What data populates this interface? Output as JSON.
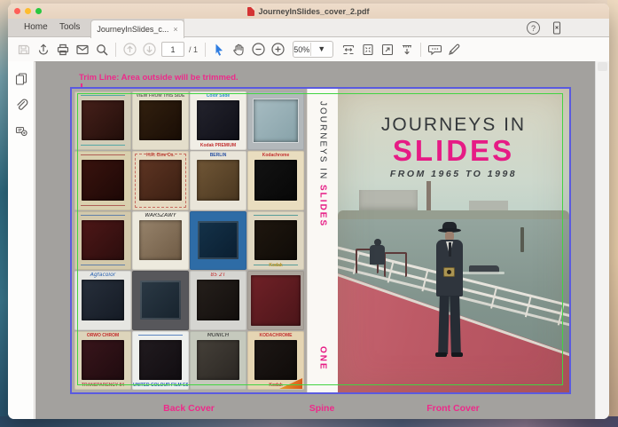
{
  "colors": {
    "accent_pink": "#ed2a8a",
    "title_pink": "#e61b85",
    "trim_green": "#42d442",
    "border_blue": "#5a5ae0",
    "select_blue": "#2f7de1"
  },
  "window": {
    "title": "JourneyInSlides_cover_2.pdf",
    "tab_home": "Home",
    "tab_tools": "Tools",
    "tab_document": "JourneyInSlides_c...",
    "tab_close": "×",
    "help": "?"
  },
  "toolbar": {
    "page_current": "1",
    "page_total": "/ 1",
    "zoom_level": "50%"
  },
  "annotations": {
    "trim_note": "Trim Line: Area outside will be trimmed.",
    "back_cover_label": "Back Cover",
    "spine_label": "Spine",
    "front_cover_label": "Front Cover"
  },
  "cover": {
    "front_title_line1": "JOURNEYS IN",
    "front_title_line2": "SLIDES",
    "front_subtitle": "FROM 1965 TO 1998",
    "spine_title_line1": "JOURNEYS IN",
    "spine_title_line2": "SLIDES",
    "spine_volume": "ONE"
  },
  "back_cover": {
    "slides": [
      {
        "f": "#d2cdb8",
        "p1": "#46201a",
        "p2": "#220e0a",
        "rules": "#2a9aa0"
      },
      {
        "f": "#e4decb",
        "p1": "#32200f",
        "p2": "#190d05",
        "t": "VIEW FROM THIS SIDE",
        "tc": "#6a675f"
      },
      {
        "f": "#f1eee6",
        "p1": "#23232d",
        "p2": "#101018",
        "t": "Color Slide",
        "tc": "#2d8ccc",
        "b": "Kodak PREMIUM",
        "bc": "#c23030"
      },
      {
        "f": "#b3b8bb",
        "p1": "#a7bcc2",
        "p2": "#87a2a9",
        "cls": "metal"
      },
      {
        "f": "#d9d0ae",
        "p1": "#3a130e",
        "p2": "#1d0806",
        "rules": "#a03a3a"
      },
      {
        "f": "#e5dac1",
        "p1": "#5e3523",
        "p2": "#3b1f12",
        "t": "H.R. Cine Co.",
        "tc": "#b83a30",
        "dashed": "#c05048"
      },
      {
        "f": "#e9e5d9",
        "p1": "#705636",
        "p2": "#4a3720",
        "t": "BERLIN",
        "tc": "#2a52a2"
      },
      {
        "f": "#e9ddbf",
        "p1": "#131313",
        "p2": "#070707",
        "t": "Kodachrome",
        "tc": "#c23030"
      },
      {
        "f": "#d3c9ab",
        "p1": "#4e1717",
        "p2": "#2b0d0d",
        "rules": "#3a66a8"
      },
      {
        "f": "#edeade",
        "p1": "#97836b",
        "p2": "#6f5b45",
        "t": "WARSZAWY",
        "tc": "#2a2a2a",
        "hw": true
      },
      {
        "f": "#2e6ca6",
        "p1": "#143249",
        "p2": "#0a1e30",
        "cls": "plastic"
      },
      {
        "f": "#dfd7c1",
        "p1": "#1f170f",
        "p2": "#0f0b07",
        "rules": "#2a8a8a",
        "b": "Kodak",
        "bc": "#b8901a"
      },
      {
        "f": "#e6e6e2",
        "p1": "#272f3b",
        "p2": "#151b25",
        "t": "Agfacolor",
        "tc": "#2a62b2",
        "hw": true
      },
      {
        "f": "#57575b",
        "p1": "#2b3945",
        "p2": "#17232d",
        "cls": "plastic"
      },
      {
        "f": "#d5d5d1",
        "p1": "#251f1b",
        "p2": "#130f0d",
        "t": "85 2T",
        "tc": "#c23030",
        "hw": true
      },
      {
        "f": "#aba49c",
        "p1": "#702127",
        "p2": "#4b1519",
        "big": true
      },
      {
        "f": "#ddd5bb",
        "p1": "#39151b",
        "p2": "#1f0b0f",
        "t": "ORWO CHROM",
        "tc": "#c22828",
        "b": "TRANSPARENCY 84",
        "bc": "#b05050"
      },
      {
        "f": "#edefed",
        "p1": "#211b1f",
        "p2": "#110d11",
        "rules": "#2a62b2",
        "b": "UNITED COLOUR FILM EST.",
        "bc": "#2a62b2"
      },
      {
        "f": "#c5c9bd",
        "p1": "#454039",
        "p2": "#2b2723",
        "t": "MUNICH",
        "tc": "#2a2a2a",
        "hw": true
      },
      {
        "f": "#e5d5b3",
        "p1": "#1d1715",
        "p2": "#0f0b09",
        "t": "KODACHROME",
        "tc": "#c23030",
        "b": "Kodak",
        "bc": "#c23030",
        "swoosh": true
      }
    ]
  }
}
